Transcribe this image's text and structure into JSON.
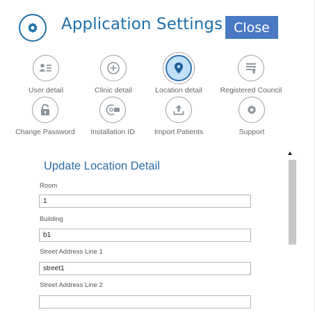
{
  "header": {
    "title": "Application Settings",
    "close_label": "Close",
    "icon": "gear-icon"
  },
  "nav": [
    {
      "label": "User detail",
      "icon": "user-card-icon",
      "active": false
    },
    {
      "label": "Clinic detail",
      "icon": "plus-circle-icon",
      "active": false
    },
    {
      "label": "Location detail",
      "icon": "location-pin-icon",
      "active": true
    },
    {
      "label": "Registered Council",
      "icon": "certificate-icon",
      "active": false
    },
    {
      "label": "Change Password",
      "icon": "lock-icon",
      "active": false
    },
    {
      "label": "Installation ID",
      "icon": "installation-id-icon",
      "active": false
    },
    {
      "label": "Import Patients",
      "icon": "upload-icon",
      "active": false
    },
    {
      "label": "Support",
      "icon": "gear-icon",
      "active": false
    }
  ],
  "form": {
    "title": "Update Location Detail",
    "fields": [
      {
        "label": "Room",
        "value": "1"
      },
      {
        "label": "Building",
        "value": "b1"
      },
      {
        "label": "Street Address Line 1",
        "value": "street1"
      },
      {
        "label": "Street Address Line 2",
        "value": ""
      }
    ]
  },
  "colors": {
    "accent": "#1f6fab",
    "close_button": "#4a79c4",
    "active_fill": "#bfe0f6",
    "icon_gray": "#9aa0a6"
  }
}
